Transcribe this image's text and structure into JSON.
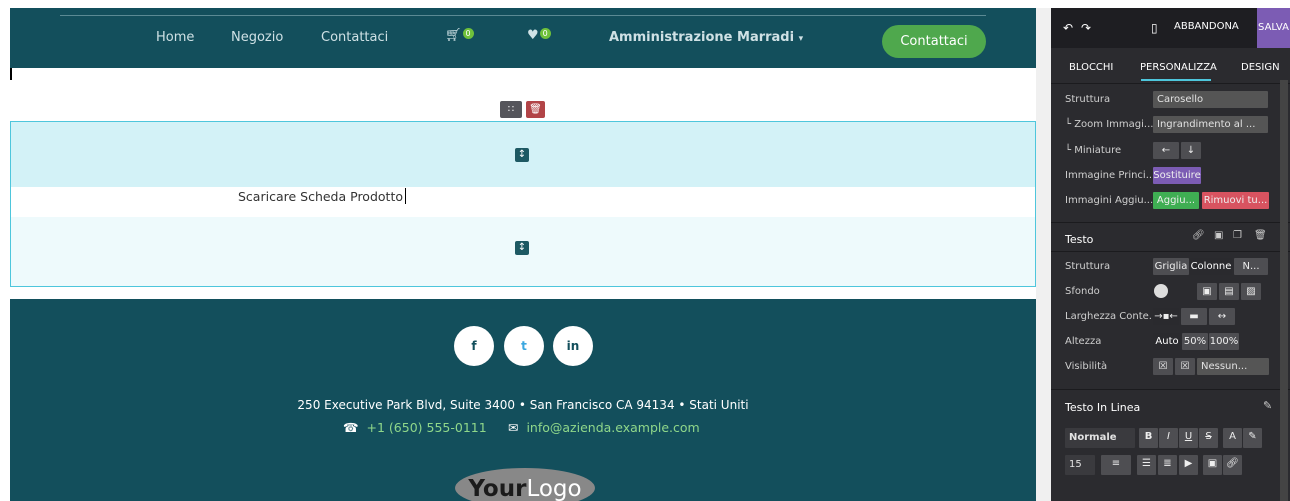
{
  "nav": {
    "items": [
      "Home",
      "Negozio",
      "Contattaci"
    ],
    "cart_count": "0",
    "wish_count": "0",
    "admin": "Amministrazione Marradi",
    "cta": "Contattaci"
  },
  "product": {
    "text": "Scaricare Scheda Prodotto"
  },
  "footer": {
    "social": [
      "f",
      "t",
      "in"
    ],
    "address": "250 Executive Park Blvd, Suite 3400 • San Francisco CA 94134 • Stati Uniti",
    "phone": "+1 (650) 555-0111",
    "email": "info@azienda.example.com",
    "logo_a": "Your",
    "logo_b": "Logo"
  },
  "panel": {
    "top": {
      "abandon": "ABBANDONA",
      "save": "SALVA"
    },
    "tabs": [
      "BLOCCHI",
      "PERSONALIZZA",
      "DESIGN"
    ],
    "struttura_label": "Struttura",
    "struttura_value": "Carosello",
    "zoom_label": "└ Zoom Immagi...",
    "zoom_value": "Ingrandimento al ...",
    "mini_label": "└ Miniature",
    "img_main_label": "Immagine Princi...",
    "img_main_btn": "Sostituire",
    "img_add_label": "Immagini Aggiu...",
    "img_add_btn": "Aggiu...",
    "img_remove_btn": "Rimuovi tu...",
    "testo_title": "Testo",
    "t_struttura_label": "Struttura",
    "t_struttura_opts": [
      "Griglia",
      "Colonne",
      "N..."
    ],
    "sfondo_label": "Sfondo",
    "larghezza_label": "Larghezza Conte...",
    "altezza_label": "Altezza",
    "altezza_opts": [
      "Auto",
      "50%",
      "100%"
    ],
    "visibilita_label": "Visibilità",
    "visibilita_value": "Nessun...",
    "inline_title": "Testo In Linea",
    "format_value": "Normale",
    "size_value": "15"
  }
}
